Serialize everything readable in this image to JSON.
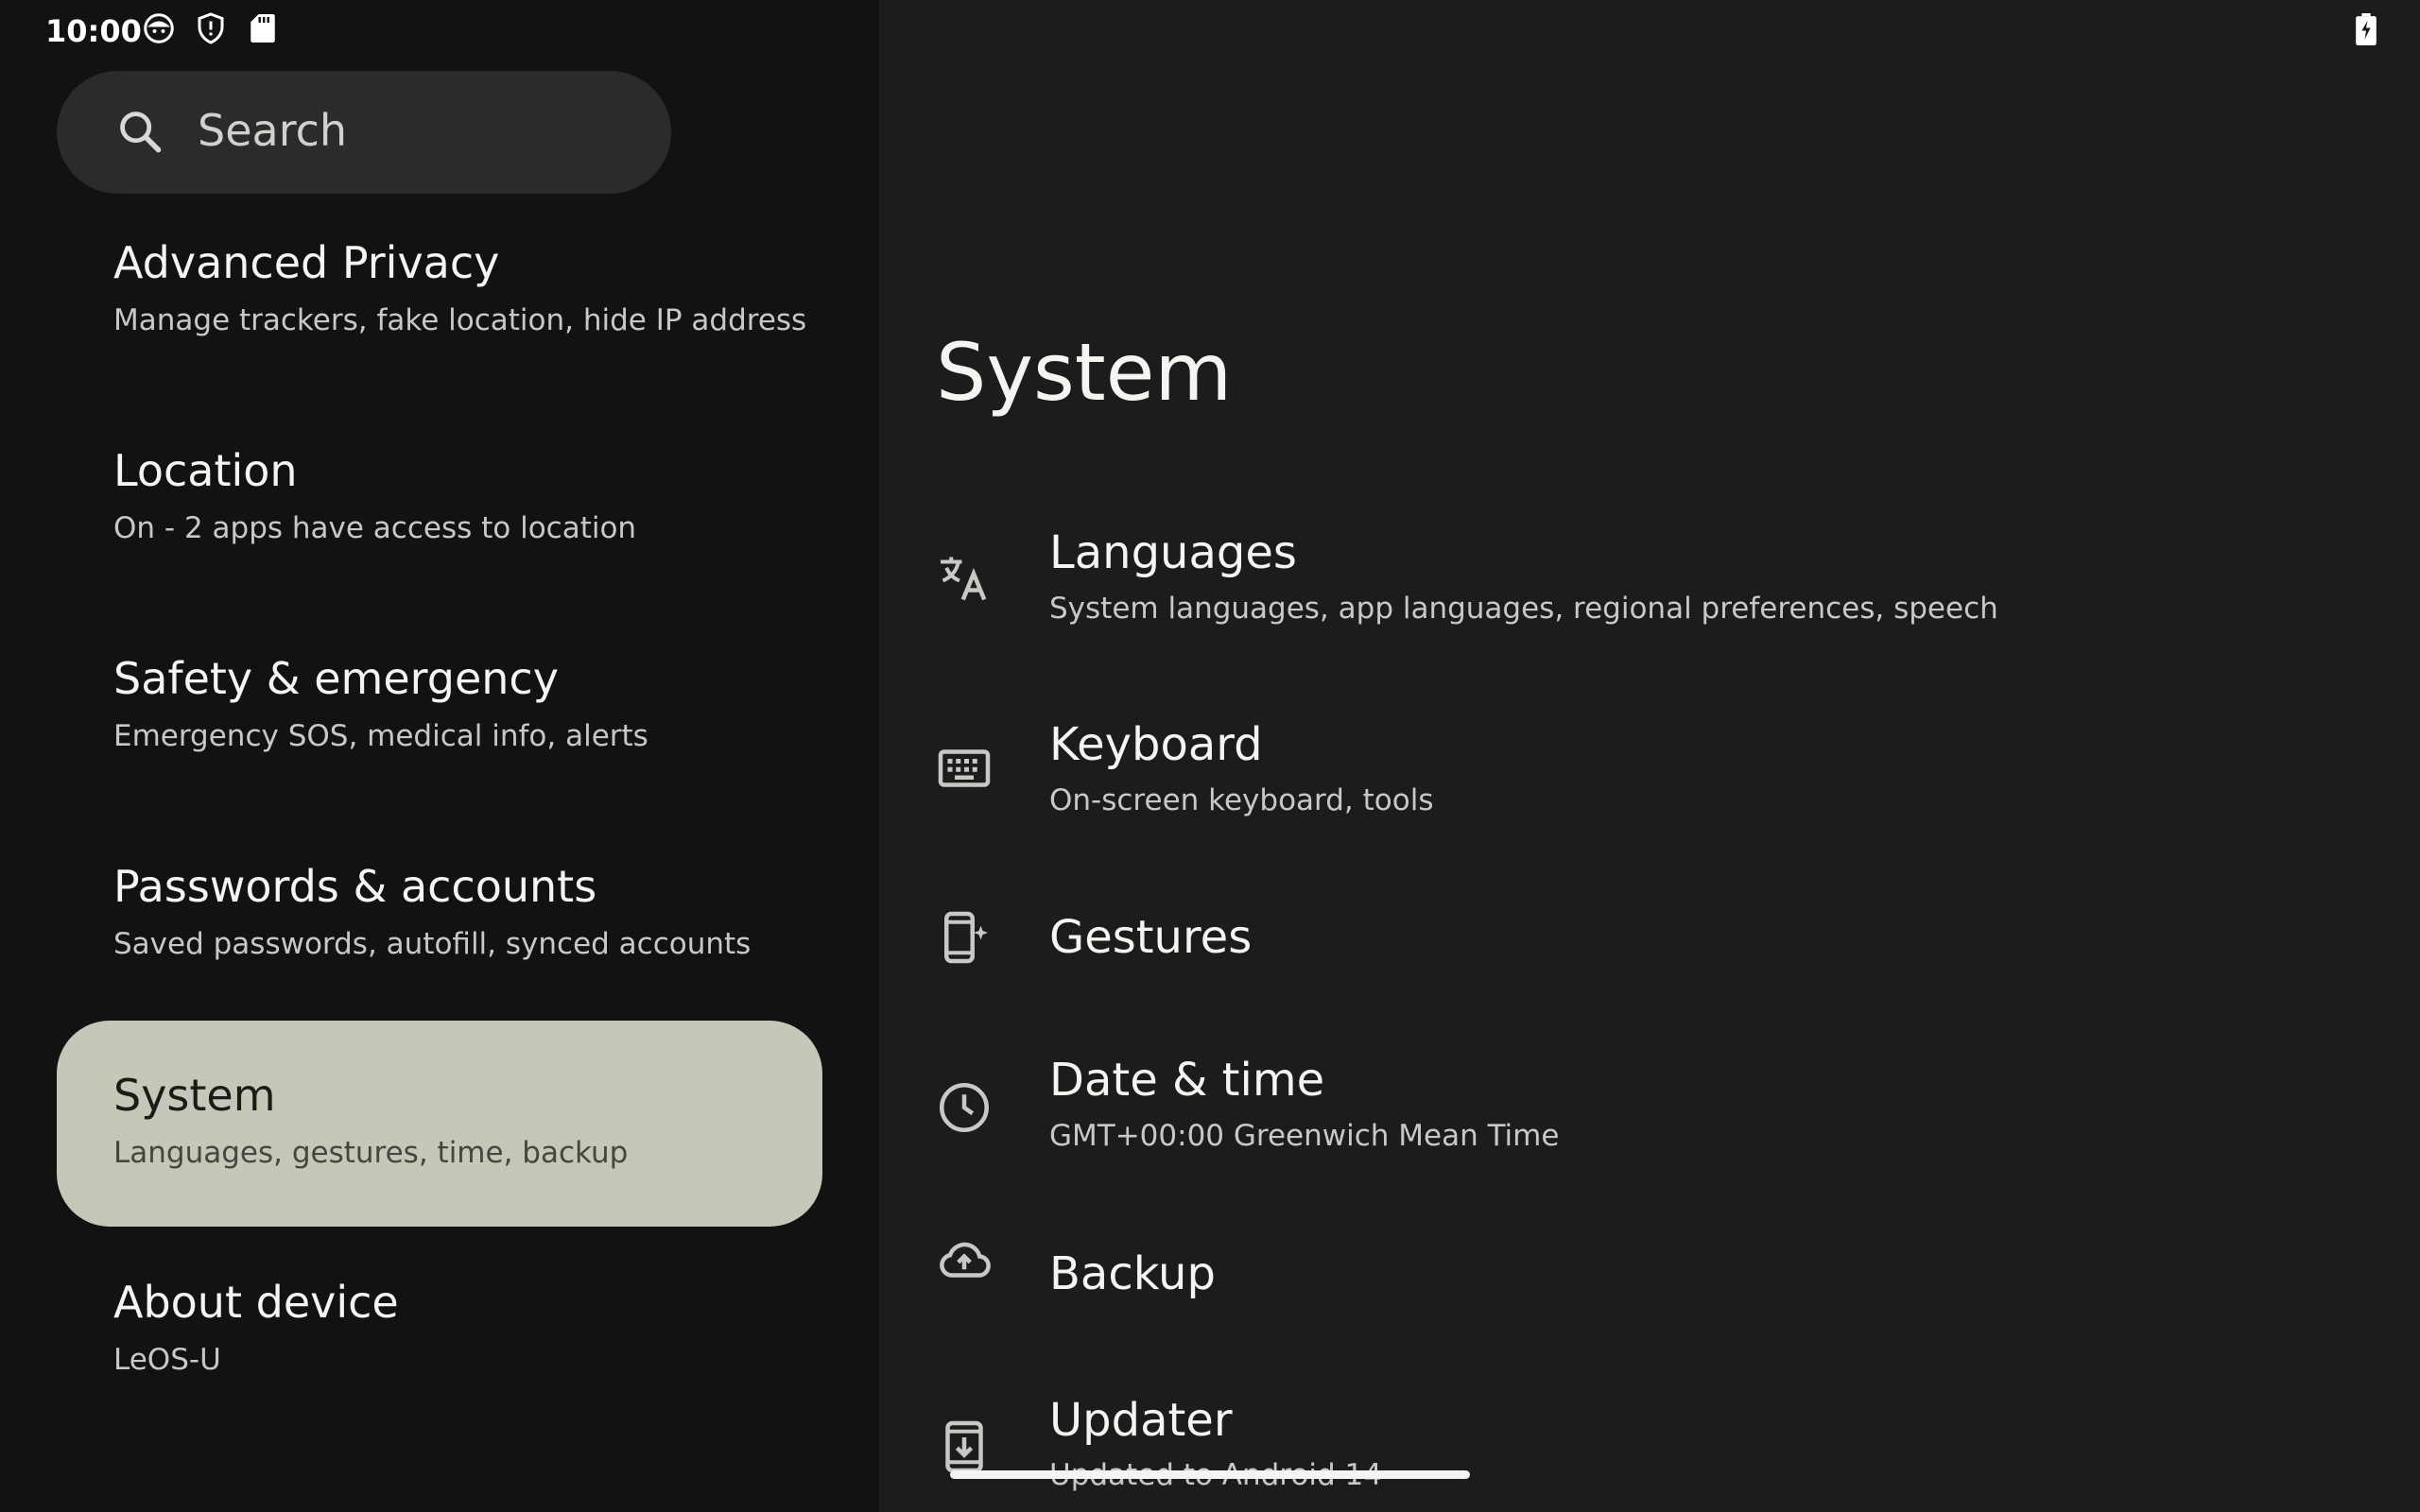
{
  "status_bar": {
    "time": "10:00",
    "icons": [
      "face-notification-icon",
      "shield-icon",
      "sd-card-icon"
    ],
    "battery_icon": "battery-charging-icon"
  },
  "search": {
    "placeholder": "Search",
    "icon": "search-icon"
  },
  "sidebar": {
    "items": [
      {
        "title": "Advanced Privacy",
        "subtitle": "Manage trackers, fake location, hide IP address",
        "selected": false
      },
      {
        "title": "Location",
        "subtitle": "On - 2 apps have access to location",
        "selected": false
      },
      {
        "title": "Safety & emergency",
        "subtitle": "Emergency SOS, medical info, alerts",
        "selected": false
      },
      {
        "title": "Passwords & accounts",
        "subtitle": "Saved passwords, autofill, synced accounts",
        "selected": false
      },
      {
        "title": "System",
        "subtitle": "Languages, gestures, time, backup",
        "selected": true
      },
      {
        "title": "About device",
        "subtitle": "LeOS-U",
        "selected": false
      }
    ]
  },
  "detail": {
    "title": "System",
    "items": [
      {
        "title": "Languages",
        "subtitle": "System languages, app languages, regional preferences, speech",
        "icon": "translate-icon"
      },
      {
        "title": "Keyboard",
        "subtitle": "On-screen keyboard, tools",
        "icon": "keyboard-icon"
      },
      {
        "title": "Gestures",
        "subtitle": "",
        "icon": "gesture-phone-icon"
      },
      {
        "title": "Date & time",
        "subtitle": "GMT+00:00 Greenwich Mean Time",
        "icon": "clock-icon"
      },
      {
        "title": "Backup",
        "subtitle": "",
        "icon": "cloud-upload-icon"
      },
      {
        "title": "Updater",
        "subtitle": "Updated to Android 14",
        "icon": "system-update-icon"
      }
    ]
  },
  "colors": {
    "left_background": "#121212",
    "right_background": "#1c1c1c",
    "selected_item": "#c4c8b8",
    "search_background": "#2b2b2b"
  }
}
